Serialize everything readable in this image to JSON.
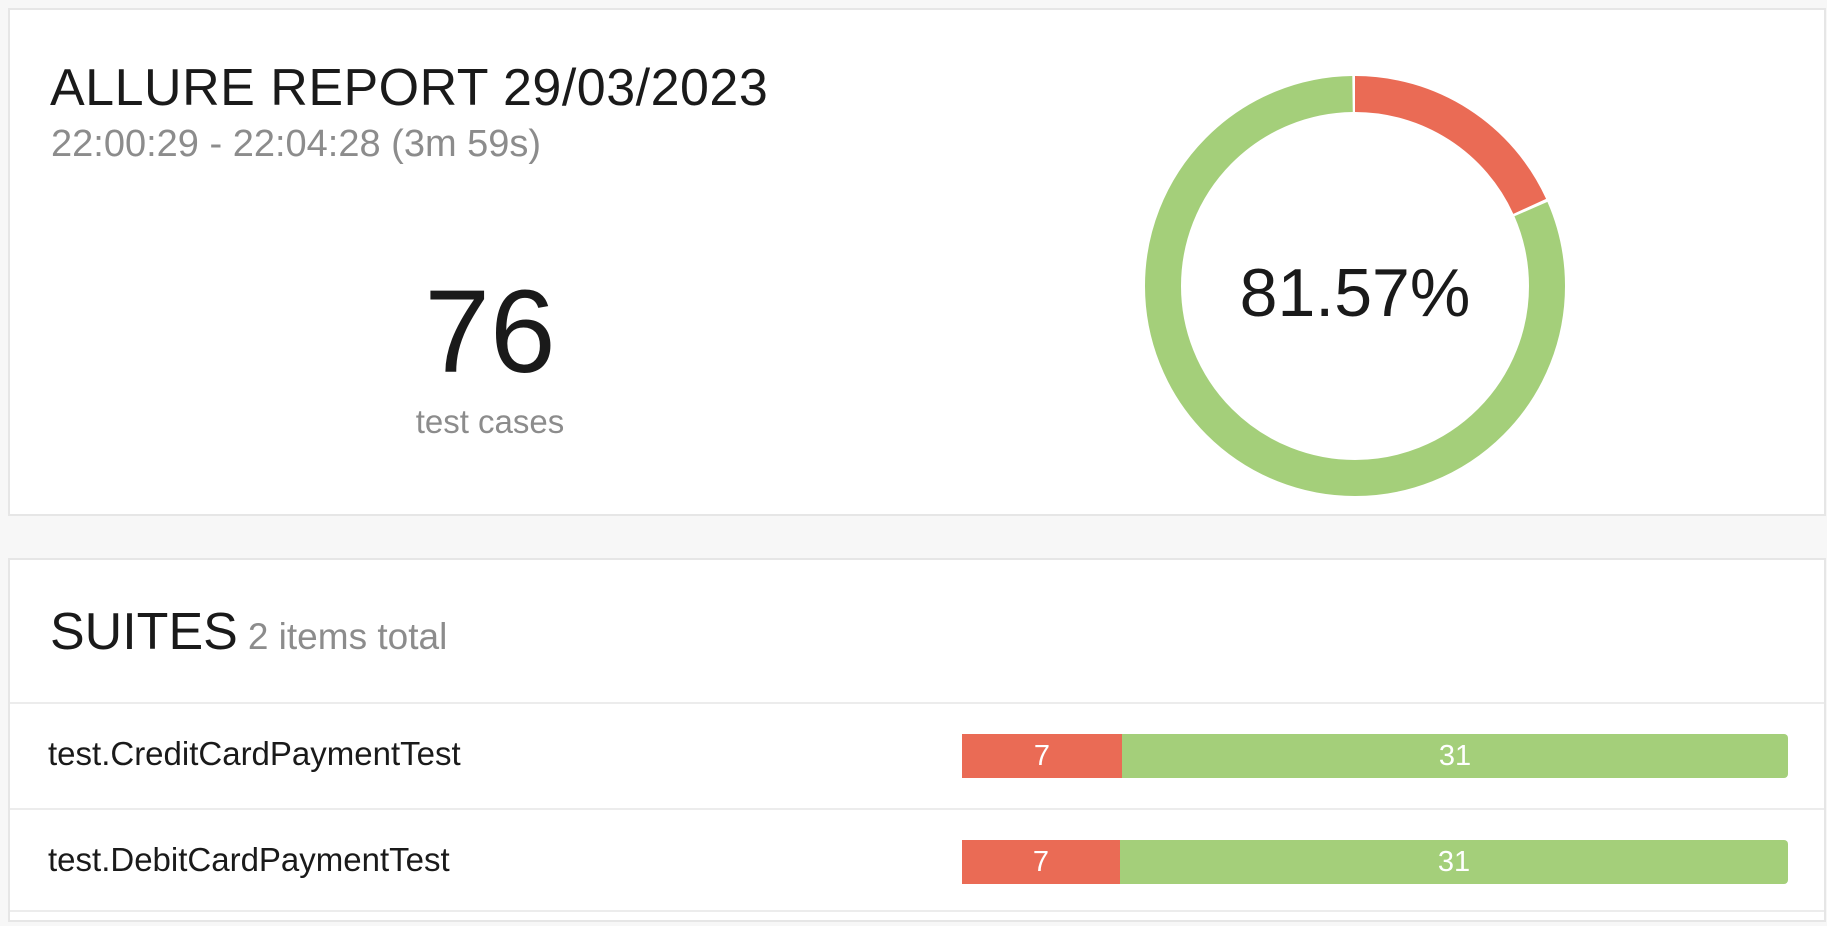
{
  "colors": {
    "failed": "#ea6b55",
    "passed": "#a4cf7a"
  },
  "summary": {
    "title": "ALLURE REPORT 29/03/2023",
    "time_range": "22:00:29 - 22:04:28 (3m 59s)",
    "test_count": "76",
    "test_count_label": "test cases",
    "success_rate_label": "81.57%",
    "success_rate_percent": 81.57,
    "failed_fraction": 0.1843,
    "passed_fraction": 0.8157
  },
  "suites": {
    "title": "SUITES",
    "count_label": "2 items total",
    "items": [
      {
        "name": "test.CreditCardPaymentTest",
        "failed": "7",
        "passed": "31"
      },
      {
        "name": "test.DebitCardPaymentTest",
        "failed": "7",
        "passed": "31"
      }
    ]
  }
}
